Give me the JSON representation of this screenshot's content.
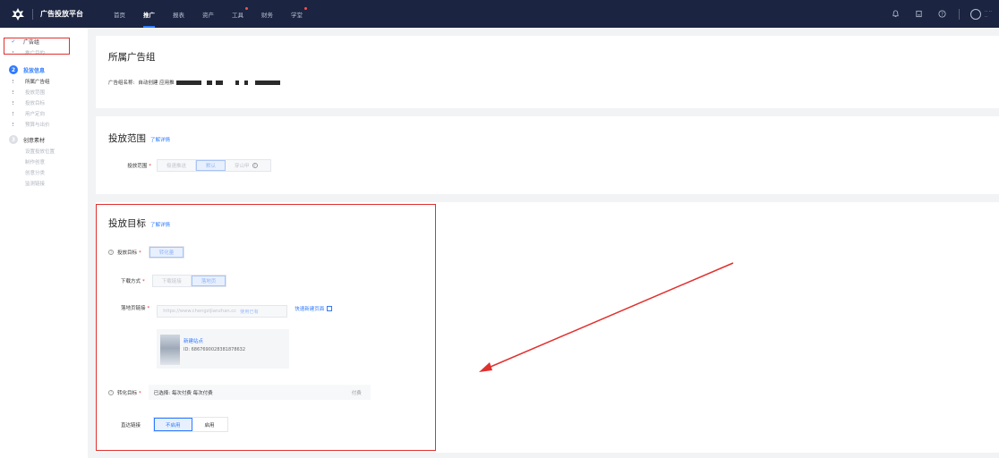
{
  "topbar": {
    "brand": "广告投放平台",
    "nav": [
      {
        "label": "首页",
        "active": false,
        "dot": false
      },
      {
        "label": "推广",
        "active": true,
        "dot": false
      },
      {
        "label": "报表",
        "active": false,
        "dot": false
      },
      {
        "label": "资产",
        "active": false,
        "dot": false
      },
      {
        "label": "工具",
        "active": false,
        "dot": true
      },
      {
        "label": "财务",
        "active": false,
        "dot": false
      },
      {
        "label": "学堂",
        "active": false,
        "dot": true
      }
    ],
    "icons": [
      "bell-icon",
      "message-icon",
      "help-icon",
      "user-icon"
    ]
  },
  "sidebar": {
    "step1": {
      "num": "✓",
      "title": "广告组",
      "subs": [
        "推广目的"
      ]
    },
    "step2": {
      "num": "2",
      "title": "投放信息",
      "subs": [
        "所属广告组",
        "投放范围",
        "投放目标",
        "用户定向",
        "预算与出价"
      ]
    },
    "step3": {
      "num": "3",
      "title": "创意素材",
      "subs": [
        "设置投放位置",
        "制作创意",
        "创意分类",
        "监测链接"
      ]
    }
  },
  "group_panel": {
    "title": "所属广告组",
    "name_label": "广告组名称:",
    "name_value": "自动创建 应用推"
  },
  "scope_panel": {
    "title": "投放范围",
    "link": "了解详情",
    "label": "投放范围",
    "options": [
      "极速推送",
      "默认",
      "穿山甲"
    ]
  },
  "target_panel": {
    "title": "投放目标",
    "link": "了解详情",
    "goal_label": "投放目标",
    "goal_option": "转化量",
    "download_label": "下载方式",
    "download_options": [
      "下载链接",
      "落地页"
    ],
    "landing_label": "落地页链接",
    "landing_label_wrap": "接",
    "landing_placeholder": "https://www.chengzijianzhan.cc",
    "landing_use": "使用已有",
    "quick_create": "快速新建页面",
    "site_name": "新建站点",
    "site_id": "ID: 6867690028381878632",
    "conv_label": "转化目标",
    "conv_selected": "已选择: 每次付费 每次付费",
    "conv_right": "付费",
    "direct_label": "直达链接",
    "direct_options": [
      "不启用",
      "启用"
    ]
  },
  "colors": {
    "accent": "#2f7bff",
    "topbar": "#1b2440",
    "highlight": "#e0312f"
  }
}
